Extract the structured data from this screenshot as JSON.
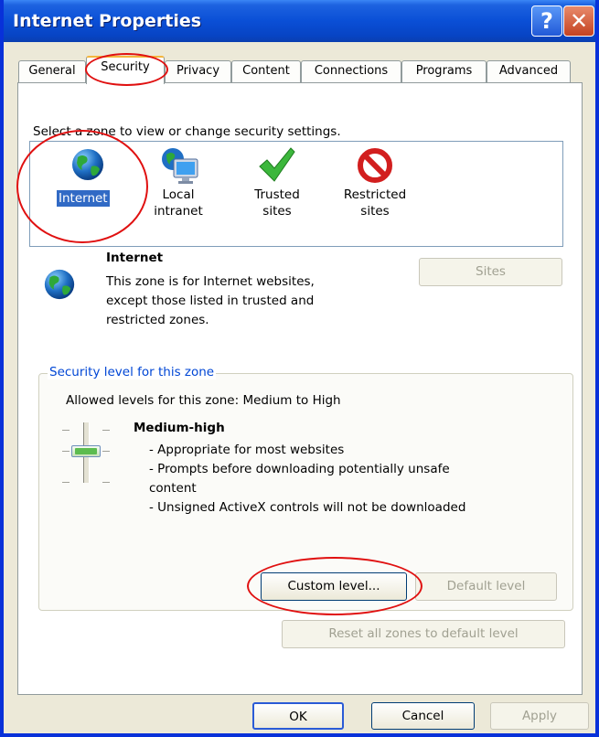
{
  "window": {
    "title": "Internet Properties",
    "help_glyph": "?",
    "close_glyph": "✕"
  },
  "tabs": [
    "General",
    "Security",
    "Privacy",
    "Content",
    "Connections",
    "Programs",
    "Advanced"
  ],
  "active_tab": "Security",
  "instruction": "Select a zone to view or change security settings.",
  "zones": [
    {
      "line1": "Internet",
      "line2": "",
      "icon": "globe-icon",
      "selected": true
    },
    {
      "line1": "Local",
      "line2": "intranet",
      "icon": "monitor-globe-icon",
      "selected": false
    },
    {
      "line1": "Trusted",
      "line2": "sites",
      "icon": "checkmark-icon",
      "selected": false
    },
    {
      "line1": "Restricted",
      "line2": "sites",
      "icon": "prohibited-icon",
      "selected": false
    }
  ],
  "zone_info": {
    "title": "Internet",
    "desc": [
      "This zone is for Internet websites,",
      "except those listed in trusted and",
      "restricted zones."
    ],
    "sites_button": "Sites"
  },
  "security_level": {
    "legend": "Security level for this zone",
    "allowed": "Allowed levels for this zone: Medium to High",
    "level_name": "Medium-high",
    "bullets": [
      "- Appropriate for most websites",
      "- Prompts before downloading potentially unsafe",
      "content",
      "- Unsigned ActiveX controls will not be downloaded"
    ],
    "custom_button": "Custom level...",
    "default_button": "Default level"
  },
  "reset_button": "Reset all zones to default level",
  "footer": {
    "ok": "OK",
    "cancel": "Cancel",
    "apply": "Apply"
  },
  "colors": {
    "title_bar": "#0a4fd6",
    "annotation": "#e01010",
    "selection": "#316ac5"
  }
}
